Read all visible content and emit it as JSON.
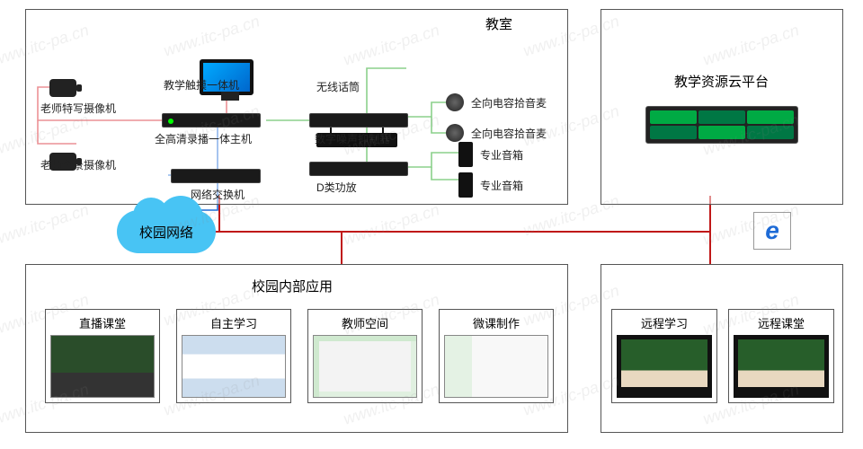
{
  "watermark_text": "www.itc-pa.cn",
  "classroom": {
    "title": "教室",
    "devices": {
      "camera_closeup": "老师特写摄像机",
      "camera_panorama": "老师全景摄像机",
      "touch_display": "教学触摸一体机",
      "recorder_host": "全高清录播一体主机",
      "network_switch": "网络交换机",
      "wireless_mic": "无线话筒",
      "noise_suppressor": "数字噪声抑制器",
      "class_d_amp": "D类功放",
      "omni_mic_1": "全向电容拾音麦",
      "omni_mic_2": "全向电容拾音麦",
      "speaker_1": "专业音箱",
      "speaker_2": "专业音箱"
    }
  },
  "cloud_platform": {
    "title": "教学资源云平台"
  },
  "campus_network": {
    "label": "校园网络"
  },
  "internal_apps": {
    "title": "校园内部应用",
    "items": [
      {
        "label": "直播课堂"
      },
      {
        "label": "自主学习"
      },
      {
        "label": "教师空间"
      },
      {
        "label": "微课制作"
      }
    ]
  },
  "remote_apps": {
    "items": [
      {
        "label": "远程学习"
      },
      {
        "label": "远程课堂"
      }
    ]
  },
  "link_colors": {
    "video": "#d8232a",
    "audio": "#16a016",
    "network": "#1e6bd6",
    "backbone": "#c01818"
  }
}
